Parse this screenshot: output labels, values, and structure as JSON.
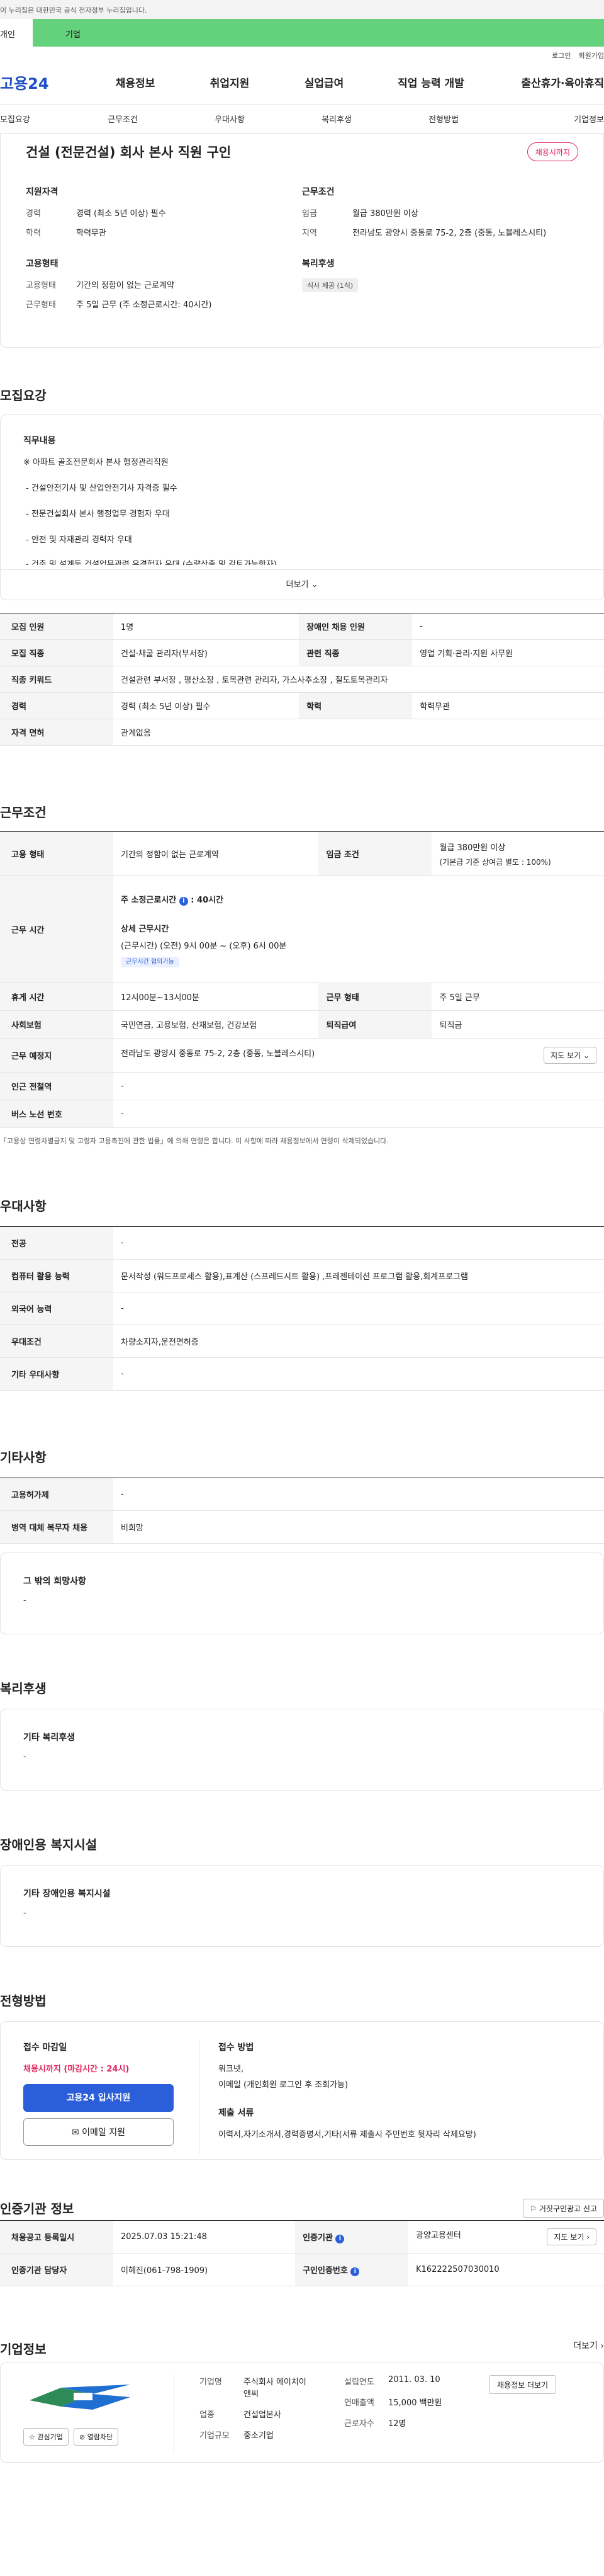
{
  "top": {
    "gov_text": "이 누리집은 대한민국 공식 전자정부 누리집입니다.",
    "tab_personal": "개인",
    "tab_corp": "기업",
    "login": "로그인",
    "join": "회원가입"
  },
  "gnb": {
    "logo": "고용24",
    "menu": [
      "채용정보",
      "취업지원",
      "실업급여",
      "직업 능력 개발",
      "출산휴가·육아휴직"
    ]
  },
  "subnav": [
    "모집요강",
    "근무조건",
    "우대사항",
    "복리후생",
    "전형방법",
    "기업정보"
  ],
  "job": {
    "title": "건설 (전문건설) 회사 본사 직원 구인",
    "status": "채용시까지",
    "qual_h": "지원자격",
    "exp_k": "경력",
    "exp_v": "경력 (최소 5년 이상) 필수",
    "edu_k": "학력",
    "edu_v": "학력무관",
    "work_h": "근무조건",
    "wage_k": "임금",
    "wage_v": "월급 380만원 이상",
    "area_k": "지역",
    "area_v": "전라남도 광양시 중동로 75-2, 2층 (중동, 노블레스시티)",
    "emp_h": "고용형태",
    "type_k": "고용형태",
    "type_v": "기간의 정함이 없는 근로계약",
    "form_k": "근무형태",
    "form_v": "주 5일 근무 (주 소정근로시간: 40시간)",
    "wel_h": "복리후생",
    "wel_chip": "식사 제공 (1식)"
  },
  "recruit": {
    "h": "모집요강",
    "duty_h": "직무내용",
    "lines": [
      "※ 아파트 골조전문회사 본사 행정관리직원",
      "- 건설안전기사 및 산업안전기사 자격증 필수",
      "- 전문건설회사 본사 행정업무 경험자 우대",
      "- 안전 및 자재관리 경력자 우대",
      "- 건축 및 설계등 건설업무관련 유경험자 우대 (수량산출 및 검토가능한자)"
    ],
    "more": "더보기",
    "rows": [
      [
        "모집 인원",
        "1명",
        "장애인 채용 인원",
        "-"
      ],
      [
        "모집 직종",
        "건설·채굴 관리자(부서장)",
        "관련 직종",
        "영업 기획·관리·지원 사무원"
      ],
      [
        "직종 키워드",
        "건설관련 부서장 , 평산소장 , 토목관련 관리자, 가스사추소장 , 철도토목관리자",
        "",
        ""
      ],
      [
        "경력",
        "경력 (최소 5년 이상) 필수",
        "학력",
        "학력무관"
      ],
      [
        "자격 면허",
        "관계없음",
        "",
        ""
      ]
    ]
  },
  "cond": {
    "h": "근무조건",
    "emp_k": "고용 형태",
    "emp_v": "기간의 정함이 없는 근로계약",
    "wage_k": "임금 조건",
    "wage_v1": "월급 380만원 이상",
    "wage_v2": "(기본급 기준 상여금 별도 : 100%)",
    "time_k": "근무 시간",
    "weekly": "주 소정근로시간",
    "weekly_v": "40시간",
    "detail_h": "상세 근무시간",
    "detail_v": "(근무시간) (오전) 9시 00분 ~ (오후) 6시 00분",
    "flex": "근무시간 협의가능",
    "rest_k": "휴게 시간",
    "rest_v": "12시00분~13시00분",
    "form_k": "근무 형태",
    "form_v": "주 5일 근무",
    "ins_k": "사회보험",
    "ins_v": "국민연금, 고용보험, 산재보험, 건강보험",
    "ret_k": "퇴직급여",
    "ret_v": "퇴직금",
    "place_k": "근무 예정지",
    "place_v": "전라남도 광양시 중동로 75-2, 2층 (중동, 노블레스시티)",
    "map_btn": "지도 보기",
    "sub_k": "인근 전철역",
    "sub_v": "-",
    "bus_k": "버스 노선 번호",
    "bus_v": "-",
    "note": "「고용상 연령차별금지 및 고령자 고용촉진에 관한 법률」에 의해 연령은 합니다. 이 사항에 따라 채용정보에서 연령이 삭제되었습니다."
  },
  "pref": {
    "h": "우대사항",
    "rows": [
      [
        "전공",
        "-"
      ],
      [
        "컴퓨터 활용 능력",
        "문서작성 (워드프로세스 활용),표계산 (스프레드시트 활용) ,프레젠테이션 프로그램 활용,회계프로그램"
      ],
      [
        "외국어 능력",
        "-"
      ],
      [
        "우대조건",
        "차량소지자,운전면허증"
      ],
      [
        "기타 우대사항",
        "-"
      ]
    ]
  },
  "etc": {
    "h": "기타사항",
    "rows": [
      [
        "고용허가제",
        "-"
      ],
      [
        "병역 대체 복무자 채용",
        "비희망"
      ]
    ],
    "hope_h": "그 밖의 희망사항",
    "hope_v": "-"
  },
  "welfare": {
    "h": "복리후생",
    "box_h": "기타 복리후생",
    "box_v": "-"
  },
  "disabled": {
    "h": "장애인용 복지시설",
    "box_h": "기타 장애인용 복지시설",
    "box_v": "-"
  },
  "screen": {
    "h": "전형방법",
    "deadline_h": "접수 마감일",
    "deadline_v": "채용시까지 (마감시간 : 24시)",
    "apply_btn": "고용24 입사지원",
    "email_btn": "이메일 지원",
    "method_h": "접수 방법",
    "method_v1": "워크넷,",
    "method_v2": "이메일 (개인회원 로그인 후 조회가능)",
    "docs_h": "제출 서류",
    "docs_v": "이력서,자기소개서,경력증명서,기타(서류 제출시 주민번호 뒷자리 삭제요망)"
  },
  "cert": {
    "h": "인증기관 정보",
    "report": "거짓구인광고 신고",
    "reg_k": "채용공고 등록일시",
    "reg_v": "2025.07.03 15:21:48",
    "org_k": "인증기관",
    "org_v": "광양고용센터",
    "map_btn": "지도 보기",
    "mgr_k": "인증기관 담당자",
    "mgr_v": "이혜진(061-798-1909)",
    "no_k": "구인인증번호",
    "no_v": "K162222507030010"
  },
  "company": {
    "h": "기업정보",
    "more": "더보기",
    "fav": "관심기업",
    "block": "열람차단",
    "name_k": "기업명",
    "name_v": "주식회사 에이치이앤씨",
    "ind_k": "업종",
    "ind_v": "건설업본사",
    "size_k": "기업규모",
    "size_v": "중소기업",
    "est_k": "설립연도",
    "est_v": "2011. 03. 10",
    "sales_k": "연매출액",
    "sales_v": "15,000 백만원",
    "emp_k": "근로자수",
    "emp_v": "12명",
    "jobs_btn": "채용정보 더보기"
  }
}
